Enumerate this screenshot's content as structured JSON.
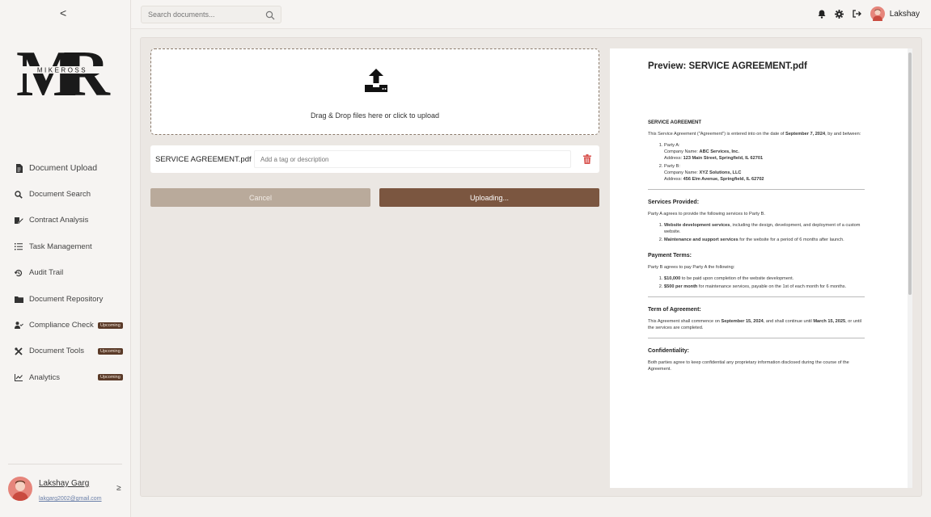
{
  "sidebar": {
    "collapse_glyph": "<",
    "logo_text": "MIKEROSS",
    "items": [
      {
        "label": "Document Upload",
        "icon": "file-icon"
      },
      {
        "label": "Document Search",
        "icon": "search-icon"
      },
      {
        "label": "Contract Analysis",
        "icon": "pen-icon"
      },
      {
        "label": "Task Management",
        "icon": "list-icon"
      },
      {
        "label": "Audit Trail",
        "icon": "history-icon"
      },
      {
        "label": "Document Repository",
        "icon": "folder-icon"
      },
      {
        "label": "Compliance Check",
        "icon": "user-check-icon",
        "badge": "Upcoming"
      },
      {
        "label": "Document Tools",
        "icon": "tools-icon",
        "badge": "Upcoming"
      },
      {
        "label": "Analytics",
        "icon": "chart-icon",
        "badge": "Upcoming"
      }
    ],
    "user": {
      "name": "Lakshay Garg",
      "email": "lakgarg2002@gmail.com",
      "chevron": "≥"
    }
  },
  "topbar": {
    "search_placeholder": "Search documents...",
    "user_name": "Lakshay"
  },
  "upload": {
    "dropzone_text": "Drag & Drop files here or click to upload",
    "file_name": "SERVICE AGREEMENT.pdf",
    "tag_placeholder": "Add a tag or description",
    "cancel_label": "Cancel",
    "upload_label": "Uploading..."
  },
  "preview": {
    "title": "Preview: SERVICE AGREEMENT.pdf",
    "doc": {
      "heading": "SERVICE AGREEMENT",
      "intro_pre": "This Service Agreement (\"Agreement\") is entered into on the date of ",
      "intro_date": "September 7, 2024",
      "intro_post": ", by and between:",
      "party_a_label": "Party A:",
      "party_a_company_pre": "Company Name: ",
      "party_a_company": "ABC Services, Inc.",
      "party_a_address_pre": "Address: ",
      "party_a_address": "123 Main Street, Springfield, IL 62701",
      "party_b_label": "Party B:",
      "party_b_company_pre": "Company Name: ",
      "party_b_company": "XYZ Solutions, LLC",
      "party_b_address_pre": "Address: ",
      "party_b_address": "456 Elm Avenue, Springfield, IL 62702",
      "services_title": "Services Provided:",
      "services_intro": "Party A agrees to provide the following services to Party B.",
      "service_1_b": "Website development services",
      "service_1_rest": ", including the design, development, and deployment of a custom website.",
      "service_2_b": "Maintenance and support services",
      "service_2_rest": " for the website for a period of 6 months after launch.",
      "payment_title": "Payment Terms:",
      "payment_intro": "Party B agrees to pay Party A the following:",
      "pay_1_b": "$10,000",
      "pay_1_rest": " to be paid upon completion of the website development.",
      "pay_2_b": "$500 per month",
      "pay_2_rest": " for maintenance services, payable on the 1st of each month for 6 months.",
      "term_title": "Term of Agreement:",
      "term_pre": "This Agreement shall commence on ",
      "term_start": "September 15, 2024",
      "term_mid": ", and shall continue until ",
      "term_end": "March 15, 2025",
      "term_post": ", or until the services are completed.",
      "conf_title": "Confidentiality:",
      "conf_text": "Both parties agree to keep confidential any proprietary information disclosed during the course of the Agreement."
    }
  },
  "colors": {
    "accent": "#7b5640",
    "badge": "#5a3a28",
    "delete": "#d9534f"
  }
}
